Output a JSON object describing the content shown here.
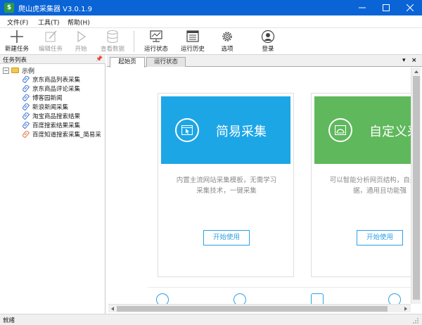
{
  "window": {
    "title": "爬山虎采集器 V3.0.1.9",
    "app_icon_glyph": "$",
    "controls": [
      "minimize",
      "maximize",
      "close"
    ]
  },
  "menu": {
    "items": [
      "文件(F)",
      "工具(T)",
      "帮助(H)"
    ]
  },
  "toolbar": {
    "buttons": [
      {
        "label": "新建任务",
        "icon": "plus-icon",
        "enabled": true
      },
      {
        "label": "编辑任务",
        "icon": "edit-icon",
        "enabled": false
      },
      {
        "label": "开始",
        "icon": "play-icon",
        "enabled": false
      },
      {
        "label": "查看数据",
        "icon": "database-icon",
        "enabled": false
      },
      {
        "label": "运行状态",
        "icon": "monitor-icon",
        "enabled": true
      },
      {
        "label": "运行历史",
        "icon": "history-icon",
        "enabled": true
      },
      {
        "label": "选项",
        "icon": "gear-icon",
        "enabled": true
      },
      {
        "label": "登录",
        "icon": "user-icon",
        "enabled": true
      }
    ]
  },
  "task_panel": {
    "title": "任务列表",
    "pin_glyph": "📌",
    "root": {
      "label": "示例",
      "expander": "−"
    },
    "items": [
      {
        "label": "京东商品列表采集",
        "icon_color": "#3b6fd6"
      },
      {
        "label": "京东商品评论采集",
        "icon_color": "#3b6fd6"
      },
      {
        "label": "博客园新闻",
        "icon_color": "#3b6fd6"
      },
      {
        "label": "新浪新闻采集",
        "icon_color": "#3b6fd6"
      },
      {
        "label": "淘宝商品搜索结果",
        "icon_color": "#3b6fd6"
      },
      {
        "label": "百度搜索结果采集",
        "icon_color": "#3b6fd6"
      },
      {
        "label": "百度知道搜索采集_简易采",
        "icon_color": "#e0713a"
      }
    ]
  },
  "tabs": {
    "items": [
      {
        "label": "起始页",
        "active": true
      },
      {
        "label": "运行状态",
        "active": false
      }
    ],
    "dropdown_glyph": "▾",
    "close_glyph": "×"
  },
  "start_page": {
    "cards": [
      {
        "title": "简易采集",
        "color": "#1ca6e6",
        "description": "内置主流网站采集模板，无需学习采集技术，一键采集",
        "button": "开始使用"
      },
      {
        "title": "自定义采",
        "color": "#5fb85c",
        "description": "可以智能分析网页结构，自采集数据，通用且功能强",
        "button": "开始使用"
      }
    ]
  },
  "status": {
    "text": "就绪"
  }
}
